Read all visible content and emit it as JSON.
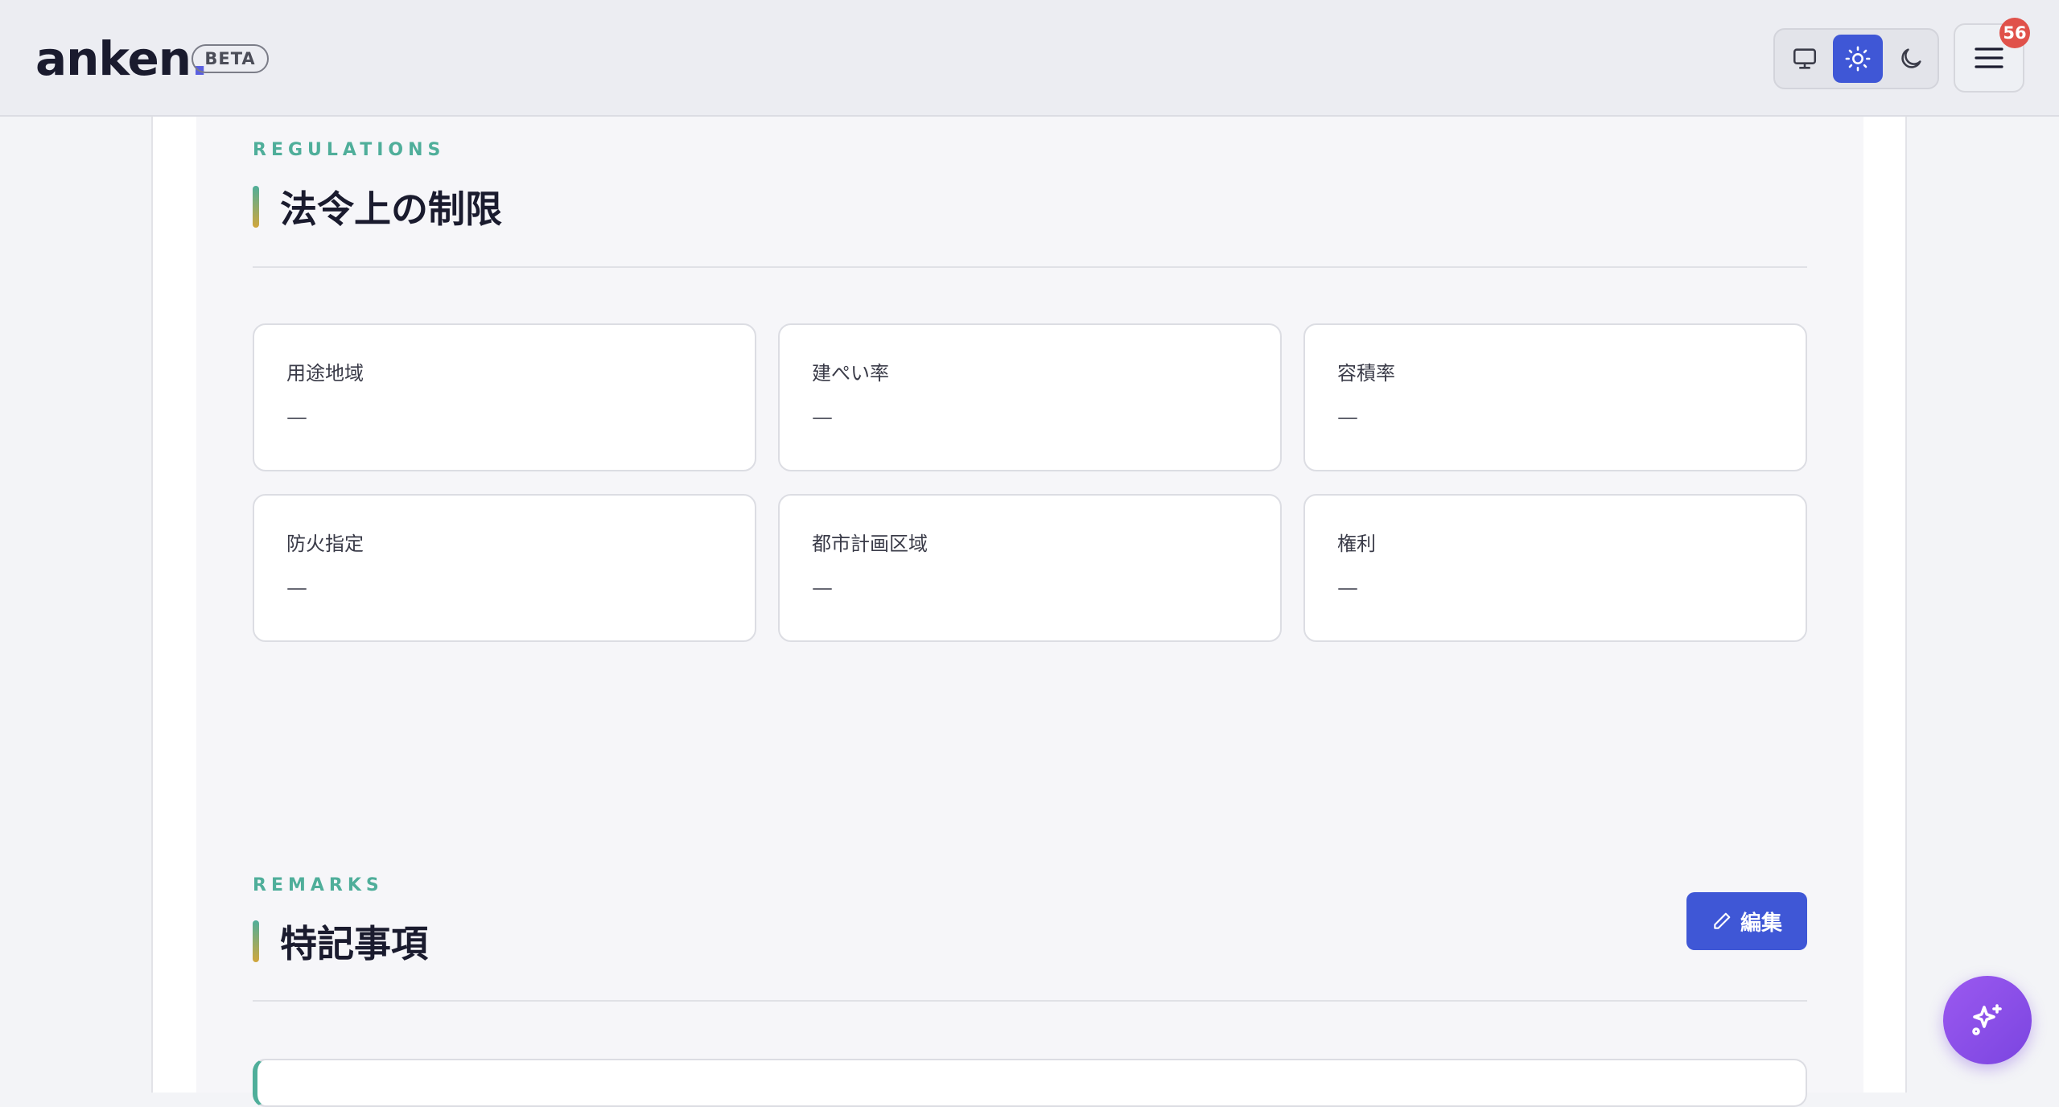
{
  "header": {
    "logo_text": "anken",
    "logo_dot": ".",
    "beta_label": "BETA",
    "theme_options": [
      "monitor-icon",
      "sun-icon",
      "moon-icon"
    ],
    "active_theme": "sun-icon",
    "menu_badge": "56"
  },
  "regulations": {
    "eyebrow": "REGULATIONS",
    "title": "法令上の制限",
    "cards": [
      {
        "label": "用途地域",
        "value": "—"
      },
      {
        "label": "建ぺい率",
        "value": "—"
      },
      {
        "label": "容積率",
        "value": "—"
      },
      {
        "label": "防火指定",
        "value": "—"
      },
      {
        "label": "都市計画区域",
        "value": "—"
      },
      {
        "label": "権利",
        "value": "—"
      }
    ]
  },
  "remarks": {
    "eyebrow": "REMARKS",
    "title": "特記事項",
    "edit_label": "編集"
  },
  "colors": {
    "accent": "#3f57d6",
    "eyebrow": "#4fae9a",
    "badge": "#e0514a",
    "fab": "#8b4fe8"
  }
}
